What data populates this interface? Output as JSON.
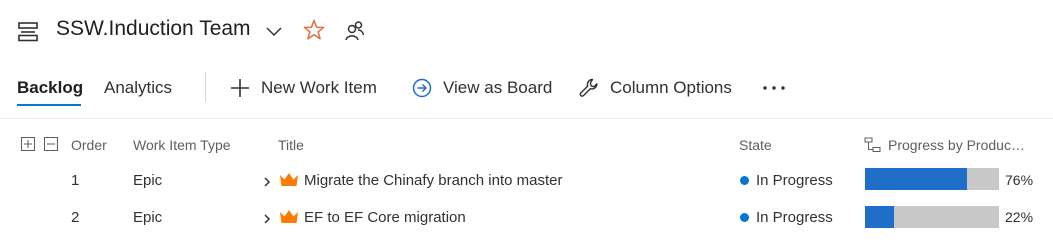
{
  "header": {
    "team_name": "SSW.Induction Team",
    "icons": [
      "backlog-board-icon",
      "chevron-down-icon",
      "star-icon",
      "team-members-icon"
    ]
  },
  "toolbar": {
    "tabs": [
      {
        "label": "Backlog",
        "active": true
      },
      {
        "label": "Analytics",
        "active": false
      }
    ],
    "commands": [
      {
        "label": "New Work Item",
        "icon": "plus-icon"
      },
      {
        "label": "View as Board",
        "icon": "arrow-circle-icon"
      },
      {
        "label": "Column Options",
        "icon": "wrench-icon"
      }
    ],
    "more_icon": "ellipsis-icon"
  },
  "grid": {
    "columns": {
      "order": "Order",
      "type": "Work Item Type",
      "title": "Title",
      "state": "State",
      "progress": "Progress by Product ..."
    },
    "rows": [
      {
        "order": "1",
        "type": "Epic",
        "title": "Migrate the Chinafy branch into master",
        "state": "In Progress",
        "progress": 0.76,
        "progress_label": "76%"
      },
      {
        "order": "2",
        "type": "Epic",
        "title": "EF to EF Core migration",
        "state": "In Progress",
        "progress": 0.22,
        "progress_label": "22%"
      }
    ]
  },
  "colors": {
    "accent": "#0078d4",
    "epic_icon": "#ff7b00",
    "star": "#e07040",
    "progress_fill": "#1f6fc8",
    "progress_track": "#c8c8c8",
    "state_dot": "#0078d4"
  }
}
